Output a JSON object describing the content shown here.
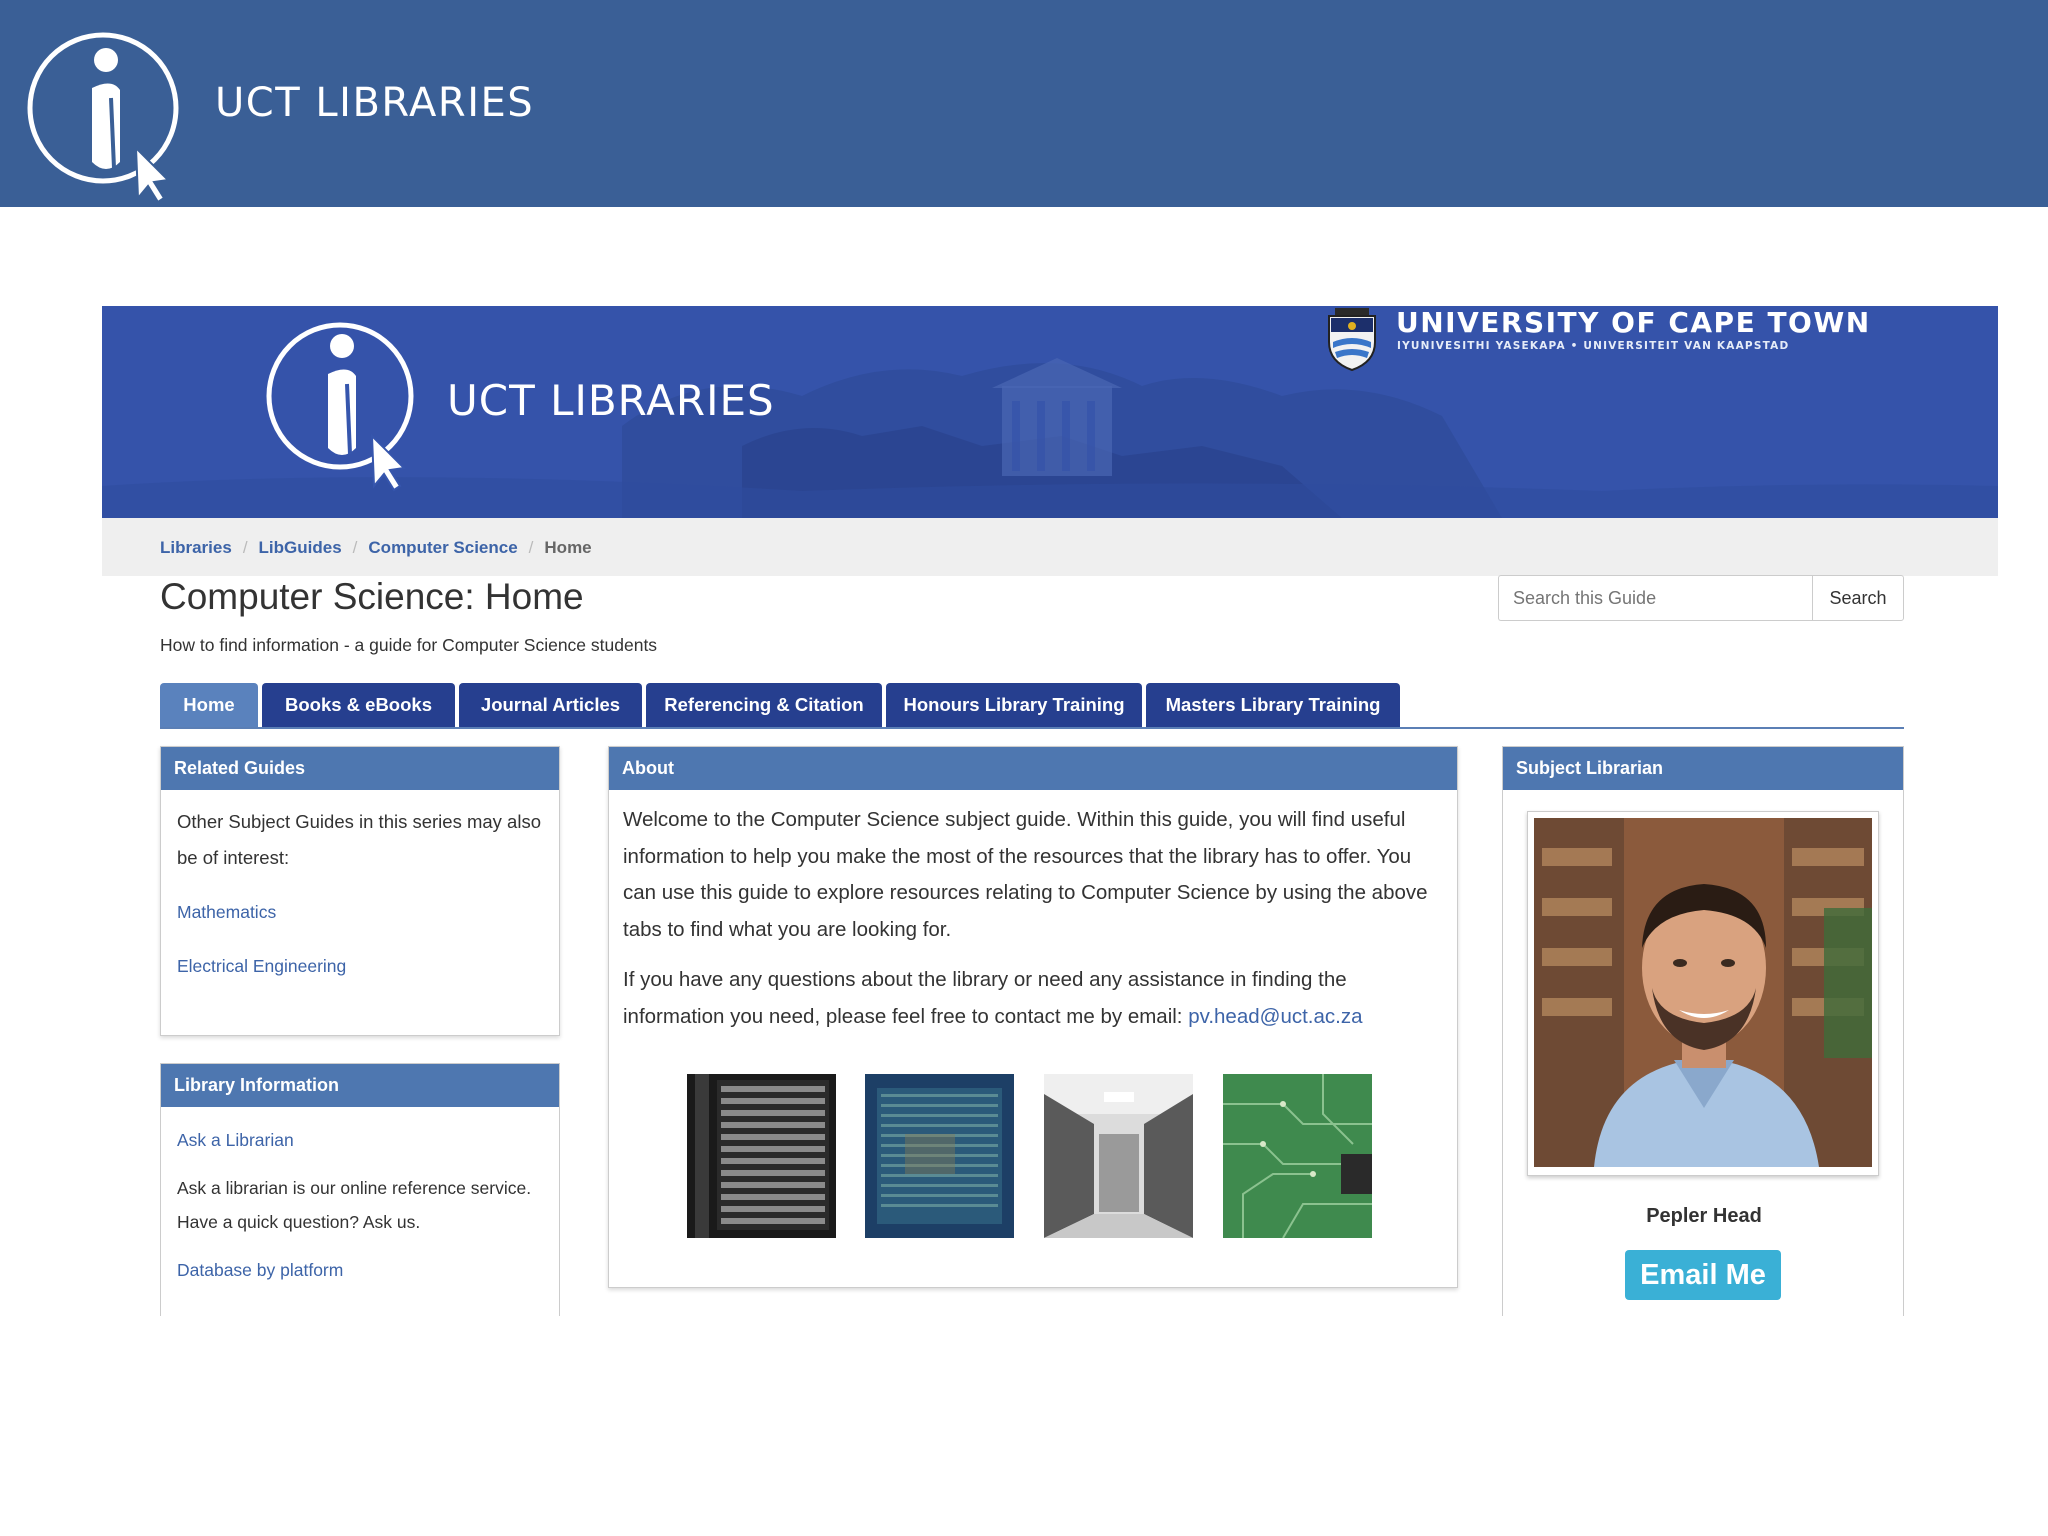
{
  "slide": {
    "title": "UCT LIBRARIES"
  },
  "banner": {
    "title": "UCT LIBRARIES",
    "university_name": "UNIVERSITY OF CAPE TOWN",
    "university_subtitle": "IYUNIVESITHI YASEKAPA • UNIVERSITEIT VAN KAAPSTAD"
  },
  "breadcrumb": [
    "Libraries",
    "LibGuides",
    "Computer Science",
    "Home"
  ],
  "guide": {
    "title": "Computer Science: Home",
    "subtitle": "How to find information - a guide for Computer Science students"
  },
  "search": {
    "placeholder": "Search this Guide",
    "button": "Search"
  },
  "tabs": [
    {
      "label": "Home",
      "active": true
    },
    {
      "label": "Books & eBooks",
      "active": false
    },
    {
      "label": "Journal Articles",
      "active": false
    },
    {
      "label": "Referencing & Citation",
      "active": false
    },
    {
      "label": "Honours Library Training",
      "active": false
    },
    {
      "label": "Masters Library Training",
      "active": false
    }
  ],
  "related_guides": {
    "title": "Related Guides",
    "intro": "Other Subject Guides in this series may also be of interest:",
    "links": [
      "Mathematics",
      "Electrical Engineering"
    ]
  },
  "library_information": {
    "title": "Library Information",
    "ask_link": "Ask a Librarian",
    "ask_text": "Ask a librarian is our online reference service. Have a quick question? Ask us.",
    "database_link": "Database by platform"
  },
  "about": {
    "title": "About",
    "paragraph1": "Welcome to the Computer Science subject guide. Within this guide, you will find useful information to help you make the most of the resources that the library has to offer. You can use this guide to explore resources relating to Computer Science by using the above tabs to find what you are looking for.",
    "paragraph2_prefix": "If you have any questions about the library or need any assistance in finding the information you need, please feel free to contact me by email: ",
    "email": "pv.head@uct.ac.za",
    "images": [
      "server-rack-image",
      "data-screen-image",
      "server-room-image",
      "circuit-board-image"
    ]
  },
  "subject_librarian": {
    "title": "Subject Librarian",
    "name": "Pepler Head",
    "button": "Email Me"
  },
  "colors": {
    "slide_bar": "#3a5f96",
    "banner": "#3656ad",
    "tab": "#263f8f",
    "tab_active": "#5a82bd",
    "panel_head": "#4e77b0",
    "link": "#3d64a8",
    "email_button": "#3ab0d6"
  }
}
